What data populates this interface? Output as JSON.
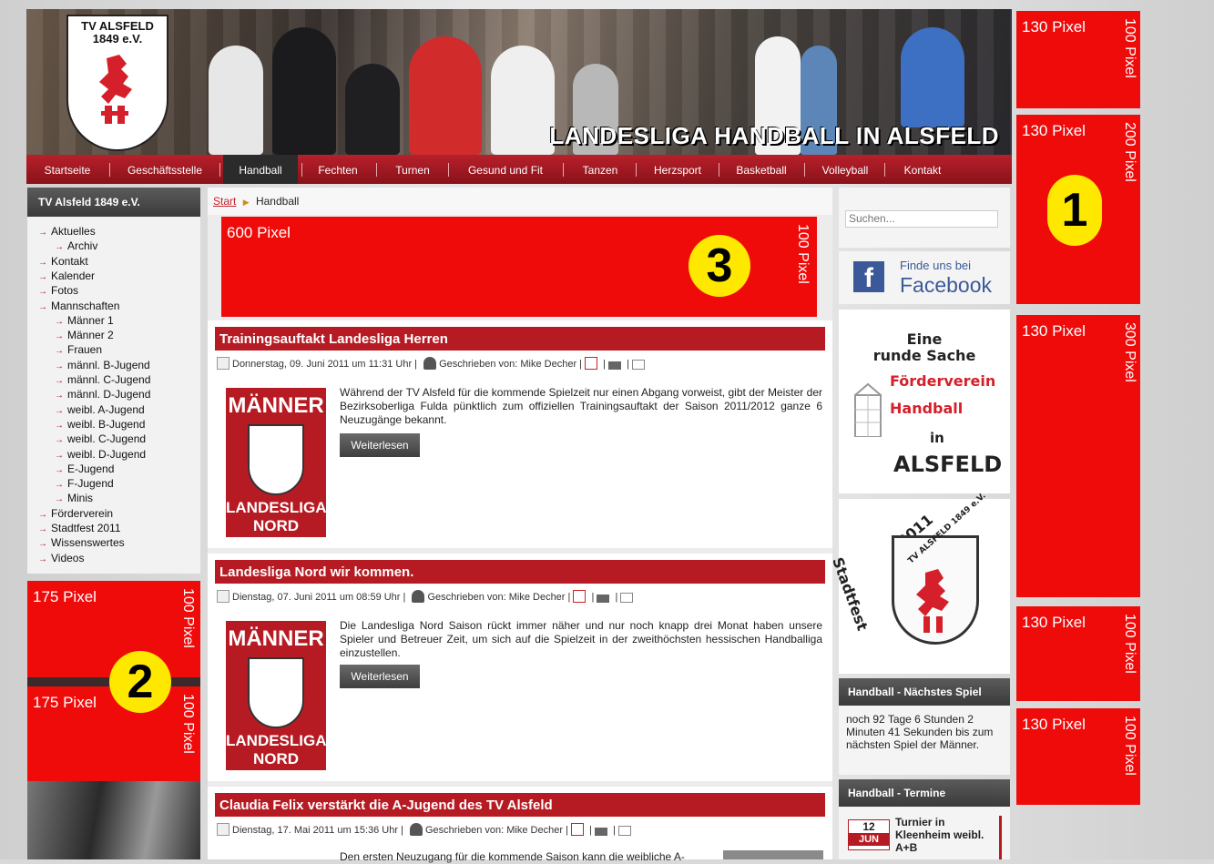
{
  "header": {
    "logo_text": "TV ALSFELD 1849 e.V.",
    "slogan": "LANDESLIGA HANDBALL IN ALSFELD"
  },
  "nav": [
    "Startseite",
    "Geschäftsstelle",
    "Handball",
    "Fechten",
    "Turnen",
    "Gesund und Fit",
    "Tanzen",
    "Herzsport",
    "Basketball",
    "Volleyball",
    "Kontakt"
  ],
  "nav_active": "Handball",
  "left_sidebar": {
    "title": "TV Alsfeld 1849 e.V.",
    "items": [
      "Aktuelles",
      "Archiv",
      "Kontakt",
      "Kalender",
      "Fotos",
      "Mannschaften",
      "Männer 1",
      "Männer 2",
      "Frauen",
      "männl. B-Jugend",
      "männl. C-Jugend",
      "männl. D-Jugend",
      "weibl. A-Jugend",
      "weibl. B-Jugend",
      "weibl. C-Jugend",
      "weibl. D-Jugend",
      "E-Jugend",
      "F-Jugend",
      "Minis",
      "Förderverein",
      "Stadtfest 2011",
      "Wissenswertes",
      "Videos"
    ]
  },
  "breadcrumb": {
    "home": "Start",
    "current": "Handball"
  },
  "ad_slots": {
    "banner_600": {
      "label": "600 Pixel",
      "height_label": "100 Pixel",
      "number": "3"
    },
    "left_1": {
      "label": "175 Pixel",
      "height_label": "100 Pixel"
    },
    "left_2": {
      "label": "175 Pixel",
      "height_label": "100 Pixel"
    },
    "left_number": "2",
    "right": [
      {
        "label": "130 Pixel",
        "height_label": "100 Pixel"
      },
      {
        "label": "130 Pixel",
        "height_label": "200 Pixel"
      },
      {
        "label": "130 Pixel",
        "height_label": "300 Pixel"
      },
      {
        "label": "130 Pixel",
        "height_label": "100 Pixel"
      },
      {
        "label": "130 Pixel",
        "height_label": "100 Pixel"
      }
    ],
    "right_number": "1"
  },
  "articles": [
    {
      "title": "Trainingsauftakt Landesliga Herren",
      "date": "Donnerstag, 09. Juni 2011 um 11:31 Uhr",
      "author": "Geschrieben von: Mike Decher",
      "text": "Während der TV Alsfeld für die kommende Spielzeit nur einen Abgang vorweist, gibt der Meister der Bezirksoberliga Fulda pünktlich zum offiziellen Trainingsauftakt der Saison 2011/2012 ganze 6 Neuzugänge bekannt.",
      "button": "Weiterlesen",
      "thumb_top": "MÄNNER",
      "thumb_bottom": "LANDESLIGA NORD"
    },
    {
      "title": "Landesliga Nord wir kommen.",
      "date": "Dienstag, 07. Juni 2011 um 08:59 Uhr",
      "author": "Geschrieben von: Mike Decher",
      "text": "Die Landesliga Nord Saison rückt immer näher und nur noch knapp drei Monat haben unsere Spieler und Betreuer Zeit, um sich auf die Spielzeit in der zweithöchsten hessischen Handballiga einzustellen.",
      "button": "Weiterlesen",
      "thumb_top": "MÄNNER",
      "thumb_bottom": "LANDESLIGA NORD"
    },
    {
      "title": "Claudia Felix verstärkt die A-Jugend des TV Alsfeld",
      "date": "Dienstag, 17. Mai 2011 um 15:36 Uhr",
      "author": "Geschrieben von: Mike Decher",
      "text": "Den ersten Neuzugang für die kommende Saison kann die weibliche A-"
    }
  ],
  "right_sidebar": {
    "search_placeholder": "Suchen...",
    "facebook_small": "Finde uns bei",
    "facebook_big": "Facebook",
    "foerder": {
      "l1": "Eine",
      "l2": "runde Sache",
      "l3": "Förderverein",
      "l4": "Handball",
      "l5": "in",
      "l6": "ALSFELD"
    },
    "stadtfest": {
      "year": "2011",
      "name": "TV ALSFELD 1849 e.V.",
      "label": "Stadtfest"
    },
    "next_game_title": "Handball - Nächstes Spiel",
    "next_game_text": "noch 92 Tage 6 Stunden 2 Minuten 41 Sekunden bis zum nächsten Spiel der Männer.",
    "termine_title": "Handball - Termine",
    "termin": {
      "day": "12",
      "month": "JUN",
      "text": "Turnier in Kleenheim weibl. A+B"
    }
  },
  "colors": {
    "accent_red": "#b61b23",
    "ad_red": "#f00b0b",
    "badge_yellow": "#ffe800",
    "facebook_blue": "#3b5998"
  }
}
